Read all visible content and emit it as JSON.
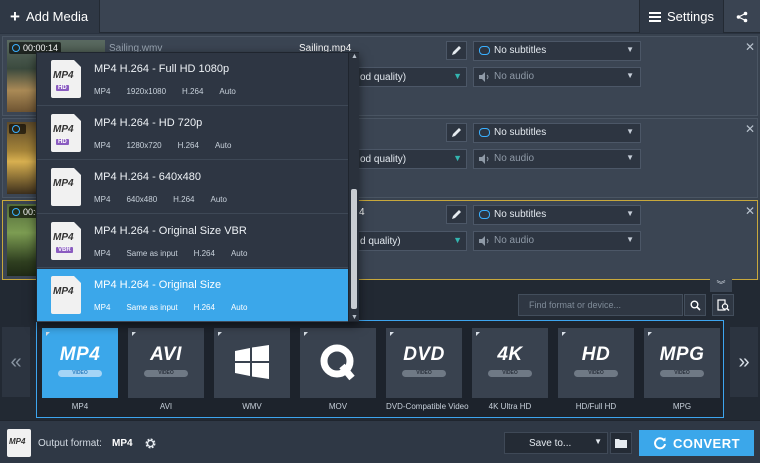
{
  "toolbar": {
    "add_media_label": "Add Media",
    "settings_label": "Settings"
  },
  "media": [
    {
      "time": "00:00:14",
      "source": "Sailing.wmv",
      "output": "Sailing.mp4",
      "quality": "od quality)",
      "subtitles": "No subtitles",
      "audio": "No audio"
    },
    {
      "time": "",
      "source": "",
      "output": "",
      "quality": "od quality)",
      "subtitles": "No subtitles",
      "audio": "No audio"
    },
    {
      "time": "00:0",
      "source": "",
      "output": "4",
      "quality": "d quality)",
      "subtitles": "No subtitles",
      "audio": "No audio"
    }
  ],
  "presets": [
    {
      "name": "MP4 H.264 - Full HD 1080p",
      "container": "MP4",
      "resolution": "1920x1080",
      "codec": "H.264",
      "audio": "Auto",
      "badge": "HD"
    },
    {
      "name": "MP4 H.264 - HD 720p",
      "container": "MP4",
      "resolution": "1280x720",
      "codec": "H.264",
      "audio": "Auto",
      "badge": "HD"
    },
    {
      "name": "MP4 H.264 - 640x480",
      "container": "MP4",
      "resolution": "640x480",
      "codec": "H.264",
      "audio": "Auto",
      "badge": ""
    },
    {
      "name": "MP4 H.264 - Original Size VBR",
      "container": "MP4",
      "resolution": "Same as input",
      "codec": "H.264",
      "audio": "Auto",
      "badge": "VBR"
    },
    {
      "name": "MP4 H.264 - Original Size",
      "container": "MP4",
      "resolution": "Same as input",
      "codec": "H.264",
      "audio": "Auto",
      "badge": ""
    }
  ],
  "selected_preset_index": 4,
  "search": {
    "placeholder": "Find format or device..."
  },
  "formats": [
    {
      "label": "MP4",
      "logo": "MP4",
      "sub": "VIDEO",
      "icon": "mp4-logo"
    },
    {
      "label": "AVI",
      "logo": "AVI",
      "sub": "VIDEO",
      "icon": "avi-logo"
    },
    {
      "label": "WMV",
      "logo": "",
      "sub": "",
      "icon": "windows-flag-icon"
    },
    {
      "label": "MOV",
      "logo": "",
      "sub": "",
      "icon": "quicktime-icon"
    },
    {
      "label": "DVD-Compatible Video",
      "logo": "DVD",
      "sub": "VIDEO",
      "icon": "dvd-logo"
    },
    {
      "label": "4K Ultra HD",
      "logo": "4K",
      "sub": "VIDEO",
      "icon": "4k-logo"
    },
    {
      "label": "HD/Full HD",
      "logo": "HD",
      "sub": "VIDEO",
      "icon": "hd-logo"
    },
    {
      "label": "MPG",
      "logo": "MPG",
      "sub": "VIDEO",
      "icon": "mpg-logo"
    }
  ],
  "selected_format_index": 0,
  "output": {
    "label": "Output format:",
    "value": "MP4",
    "icon_text": "MP4"
  },
  "save_to_label": "Save to...",
  "convert_label": "CONVERT",
  "colors": {
    "accent": "#3ba7ea",
    "active_row_border": "#c8a83c",
    "background": "#2a3340"
  }
}
